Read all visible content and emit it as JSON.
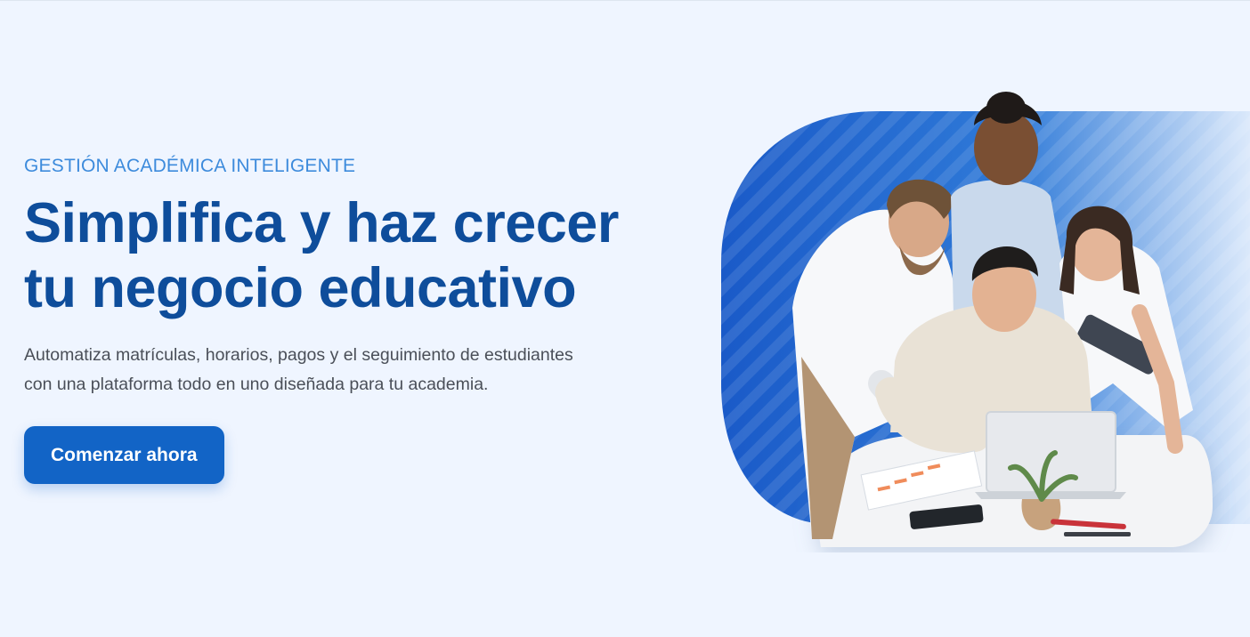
{
  "hero": {
    "eyebrow": "GESTIÓN ACADÉMICA INTELIGENTE",
    "title_line1": "Simplifica y haz crecer",
    "title_line2": "tu negocio educativo",
    "subtitle_line1": "Automatiza matrículas, horarios, pagos y el seguimiento de estudiantes",
    "subtitle_line2": "con una plataforma todo en uno diseñada para tu academia.",
    "cta_label": "Comenzar ahora"
  },
  "colors": {
    "background": "#eff5ff",
    "eyebrow": "#3d8bdc",
    "title": "#0e4d9b",
    "body_text": "#4a4f58",
    "primary": "#1264c6"
  },
  "illustration": {
    "icon": "team-working-at-laptop-photo"
  }
}
